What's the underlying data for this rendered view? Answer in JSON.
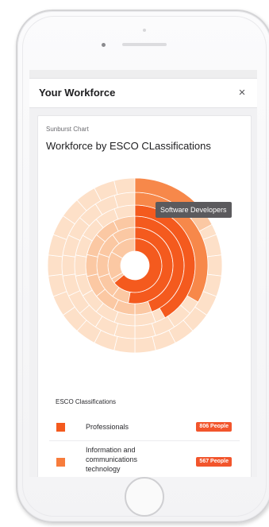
{
  "header": {
    "title": "Your Workforce",
    "close_label": "×"
  },
  "card": {
    "eyebrow": "Sunburst Chart",
    "title": "Workforce by ESCO CLassifications"
  },
  "tooltip": "Software Developers",
  "legend": {
    "title": "ESCO Classifications",
    "items": [
      {
        "label": "Professionals",
        "count": "806 People",
        "color": "#f45a1e"
      },
      {
        "label": "Information and communications technology",
        "count": "567 People",
        "color": "#f77c3c"
      }
    ]
  },
  "colors": {
    "accent": "#f2552c",
    "ring_dark": "#f45a1e",
    "ring_mid": "#f7884a",
    "ring_light": "#fbc8a3",
    "ring_pale": "#fde0c8"
  },
  "icons": {
    "close": "close-icon"
  }
}
